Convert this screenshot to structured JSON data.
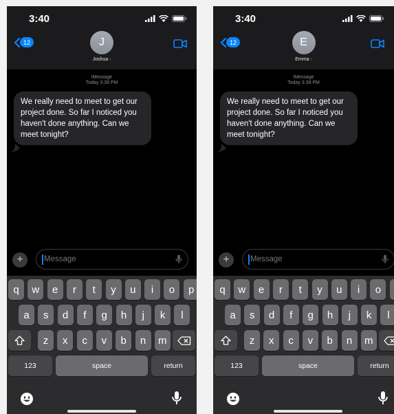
{
  "screens": [
    {
      "status_time": "3:40",
      "back_badge": "12",
      "avatar_initial": "J",
      "contact_name": "Joshua",
      "service_label": "iMessage",
      "timestamp": "Today 3:39 PM",
      "message": "We really need to meet to get our project done. So far I noticed you haven't done anything. Can we meet tonight?",
      "input_placeholder": "Message"
    },
    {
      "status_time": "3:40",
      "back_badge": "12",
      "avatar_initial": "E",
      "contact_name": "Emma",
      "service_label": "iMessage",
      "timestamp": "Today 3:39 PM",
      "message": "We really need to meet to get our project done. So far I noticed you haven't done anything. Can we meet tonight?",
      "input_placeholder": "Message"
    }
  ],
  "keyboard": {
    "row1": [
      "q",
      "w",
      "e",
      "r",
      "t",
      "y",
      "u",
      "i",
      "o",
      "p"
    ],
    "row2": [
      "a",
      "s",
      "d",
      "f",
      "g",
      "h",
      "j",
      "k",
      "l"
    ],
    "row3": [
      "z",
      "x",
      "c",
      "v",
      "b",
      "n",
      "m"
    ],
    "numbers_label": "123",
    "space_label": "space",
    "return_label": "return"
  },
  "colors": {
    "accent": "#0a84ff",
    "bubble": "#262629",
    "key": "#6b6b6e",
    "key_dark": "#464648",
    "keyboard_bg": "#2c2c2e"
  },
  "icons": [
    "back-chevron-icon",
    "video-camera-icon",
    "signal-icon",
    "wifi-icon",
    "battery-icon",
    "plus-icon",
    "microphone-icon",
    "shift-icon",
    "delete-icon",
    "emoji-icon",
    "dictation-icon"
  ]
}
